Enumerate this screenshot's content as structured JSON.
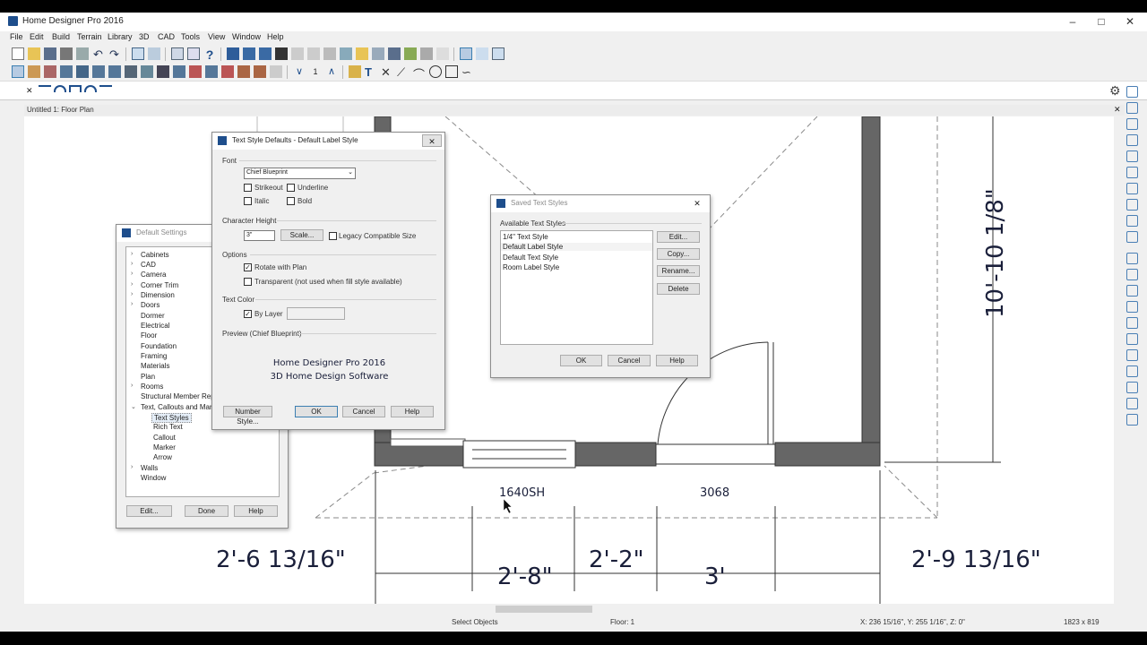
{
  "window": {
    "title": "Home Designer Pro 2016"
  },
  "menu": [
    "File",
    "Edit",
    "Build",
    "Terrain",
    "Library",
    "3D",
    "CAD",
    "Tools",
    "View",
    "Window",
    "Help"
  ],
  "plan_window": {
    "title": "Untitled 1: Floor Plan"
  },
  "status": {
    "mode": "Select Objects",
    "floor": "Floor: 1",
    "coords": "X: 236 15/16\", Y: 255 1/16\", Z: 0\"",
    "size": "1823 x 819"
  },
  "floorplan": {
    "labels": {
      "window": "1640SH",
      "door": "3068"
    },
    "dimensions": {
      "d1": "2'-6 13/16\"",
      "d2": "2'-8\"",
      "d3": "2'-2\"",
      "d4": "3'",
      "d5": "2'-9 13/16\"",
      "vertical": "10'-10 1/8\""
    }
  },
  "default_settings": {
    "title": "Default Settings",
    "items": [
      "Cabinets",
      "CAD",
      "Camera",
      "Corner Trim",
      "Dimension",
      "Doors",
      "Dormer",
      "Electrical",
      "Floor",
      "Foundation",
      "Framing",
      "Materials",
      "Plan",
      "Rooms",
      "Structural Member Rep",
      "Text, Callouts and Mark",
      "Text Styles",
      "Rich Text",
      "Callout",
      "Marker",
      "Arrow",
      "Walls",
      "Window"
    ],
    "buttons": {
      "edit": "Edit...",
      "done": "Done",
      "help": "Help"
    }
  },
  "text_style": {
    "title": "Text Style Defaults - Default Label Style",
    "font_group": "Font",
    "font_value": "Chief Blueprint",
    "strikeout": "Strikeout",
    "underline": "Underline",
    "italic": "Italic",
    "bold": "Bold",
    "height_group": "Character Height",
    "height_value": "3\"",
    "scale_button": "Scale...",
    "legacy": "Legacy Compatible Size",
    "options_group": "Options",
    "rotate": "Rotate with Plan",
    "transparent": "Transparent (not used when fill style available)",
    "color_group": "Text Color",
    "by_layer": "By Layer",
    "preview_group": "Preview (Chief Blueprint)",
    "preview_line1": "Home Designer Pro 2016",
    "preview_line2": "3D Home Design Software",
    "buttons": {
      "number_style": "Number Style...",
      "ok": "OK",
      "cancel": "Cancel",
      "help": "Help"
    }
  },
  "saved_styles": {
    "title": "Saved Text Styles",
    "group": "Available Text Styles",
    "items": [
      "1/4\" Text Style",
      "Default Label Style",
      "Default Text Style",
      "Room Label Style"
    ],
    "buttons": {
      "edit": "Edit...",
      "copy": "Copy...",
      "rename": "Rename...",
      "delete": "Delete",
      "ok": "OK",
      "cancel": "Cancel",
      "help": "Help"
    }
  }
}
